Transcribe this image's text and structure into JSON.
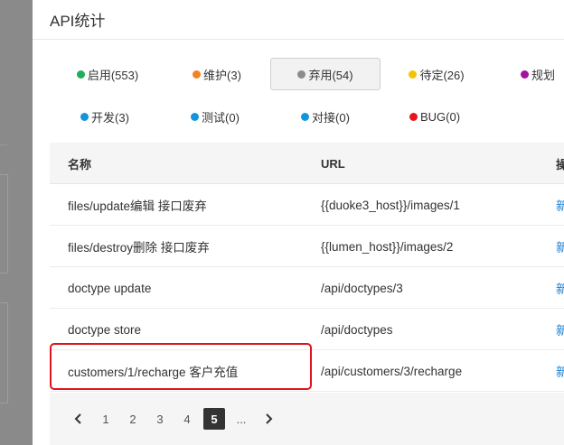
{
  "dialog": {
    "title": "API统计"
  },
  "filters": [
    {
      "label": "启用(553)",
      "color": "#1fae5b",
      "active": false
    },
    {
      "label": "维护(3)",
      "color": "#f58220",
      "active": false
    },
    {
      "label": "弃用(54)",
      "color": "#8c8c8c",
      "active": true
    },
    {
      "label": "待定(26)",
      "color": "#f5c400",
      "active": false
    },
    {
      "label": "规划",
      "color": "#a3119f",
      "active": false
    },
    {
      "label": "开发(3)",
      "color": "#1296db",
      "active": false
    },
    {
      "label": "测试(0)",
      "color": "#1296db",
      "active": false
    },
    {
      "label": "对接(0)",
      "color": "#1296db",
      "active": false
    },
    {
      "label": "BUG(0)",
      "color": "#e5161a",
      "active": false
    }
  ],
  "table": {
    "headers": {
      "name": "名称",
      "url": "URL",
      "action": "操"
    },
    "rows": [
      {
        "name": "files/update编辑 接口废弃",
        "url": "{{duoke3_host}}/images/1",
        "action": "新"
      },
      {
        "name": "files/destroy删除 接口废弃",
        "url": "{{lumen_host}}/images/2",
        "action": "新"
      },
      {
        "name": "doctype update",
        "url": "/api/doctypes/3",
        "action": "新"
      },
      {
        "name": "doctype store",
        "url": "/api/doctypes",
        "action": "新"
      },
      {
        "name": "customers/1/recharge 客户充值",
        "url": "/api/customers/3/recharge",
        "action": "新"
      }
    ]
  },
  "pagination": {
    "pages": [
      "1",
      "2",
      "3",
      "4",
      "5"
    ],
    "current": "5",
    "ellipsis": "...",
    "prev_icon": "chevron-left-icon",
    "next_icon": "chevron-right-icon"
  },
  "highlight_color": "#e0141a"
}
